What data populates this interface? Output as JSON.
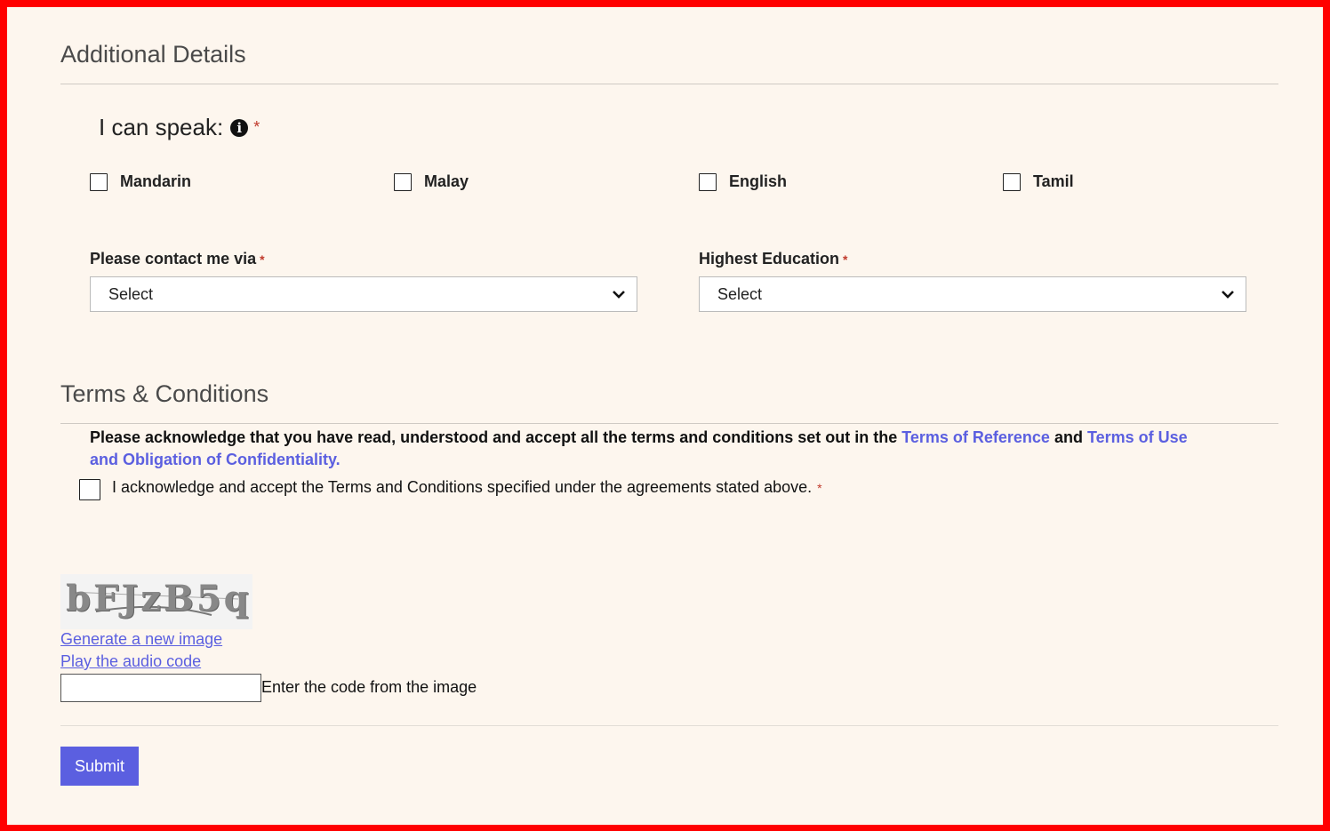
{
  "additional": {
    "title": "Additional Details",
    "speak_label": "I can speak:",
    "info_glyph": "i",
    "required_mark": "*",
    "languages": [
      "Mandarin",
      "Malay",
      "English",
      "Tamil"
    ],
    "contact_label": "Please contact me via",
    "contact_value": "Select",
    "education_label": "Highest Education",
    "education_value": "Select"
  },
  "terms": {
    "title": "Terms & Conditions",
    "text_part1": "Please acknowledge that you have read, understood and accept all the terms and conditions set out in the ",
    "link_reference": "Terms of Reference",
    "text_and": " and ",
    "link_use": "Terms of Use and Obligation of Confidentiality.",
    "ack_label": "I acknowledge and accept the Terms and Conditions specified under the agreements stated above."
  },
  "captcha": {
    "image_text": "bFJzB5q",
    "new_image_link": "Generate a new image",
    "audio_link": "Play the audio code",
    "input_value": "",
    "input_label": "Enter the code from the image"
  },
  "submit_label": "Submit",
  "colors": {
    "accent": "#5b5fe0",
    "background": "#fdf6ee",
    "border_frame": "#ff0000",
    "required": "#c0392b"
  }
}
